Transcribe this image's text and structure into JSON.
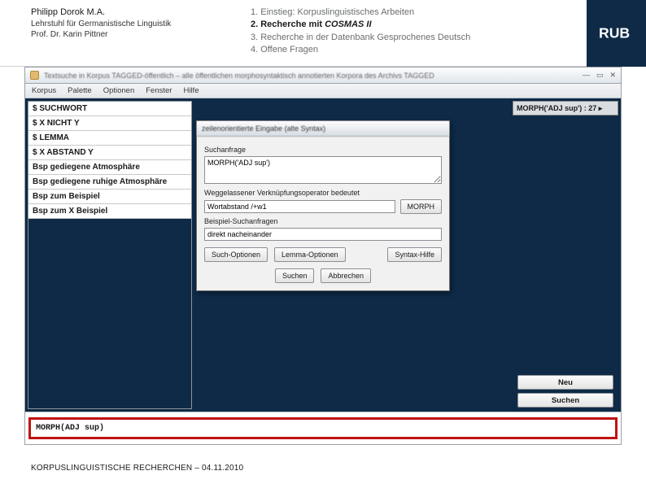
{
  "colors": {
    "navy": "#0e2a47",
    "red": "#c01212"
  },
  "header": {
    "author": {
      "name": "Philipp Dorok M.A.",
      "line2": "Lehrstuhl für Germanistische Linguistik",
      "line3": "Prof. Dr. Karin Pittner"
    },
    "outline": {
      "i1": "1. Einstieg: Korpuslinguistisches Arbeiten",
      "i2a": "2. Recherche mit ",
      "i2b": "COSMAS II",
      "i3": "3. Recherche in der Datenbank Gesprochenes Deutsch",
      "i4": "4. Offene Fragen"
    },
    "logo": "RUB"
  },
  "screenshot": {
    "window_title": "Textsuche in Korpus TAGGED-öffentlich – alle öffentlichen morphosyntaktisch annotierten Korpora des Archivs TAGGED",
    "win_min": "—",
    "win_max": "▭",
    "win_close": "✕",
    "menubar": {
      "m1": "Korpus",
      "m2": "Palette",
      "m3": "Optionen",
      "m4": "Fenster",
      "m5": "Hilfe"
    },
    "palette": {
      "r1": "$ SUCHWORT",
      "r2": "$ X NICHT Y",
      "r3": "$ LEMMA",
      "r4": "$ X ABSTAND Y",
      "r5": "Bsp gediegene Atmosphäre",
      "r6": "Bsp gediegene ruhige Atmosphäre",
      "r7": "Bsp zum Beispiel",
      "r8": "Bsp zum X Beispiel"
    },
    "right": {
      "chip": "MORPH('ADJ sup') : 27 ▸",
      "btn_new": "Neu",
      "btn_search": "Suchen"
    },
    "dialog": {
      "title": "zeilenorientierte Eingabe (alte Syntax)",
      "lbl_query": "Suchanfrage",
      "query_value": "MORPH('ADJ sup')",
      "lbl_connector": "Weggelassener Verknüpfungsoperator bedeutet",
      "connector_value": "Wortabstand /+w1",
      "btn_morph": "MORPH",
      "lbl_examples": "Beispiel-Suchanfragen",
      "examples_value": "direkt nacheinander",
      "btn_searchopts": "Such-Optionen",
      "btn_lemmaopts": "Lemma-Optionen",
      "btn_syntaxhelp": "Syntax-Hilfe",
      "btn_search": "Suchen",
      "btn_cancel": "Abbrechen"
    },
    "querystrip": "MORPH(ADJ sup)"
  },
  "footer": "KORPUSLINGUISTISCHE RECHERCHEN – 04.11.2010"
}
